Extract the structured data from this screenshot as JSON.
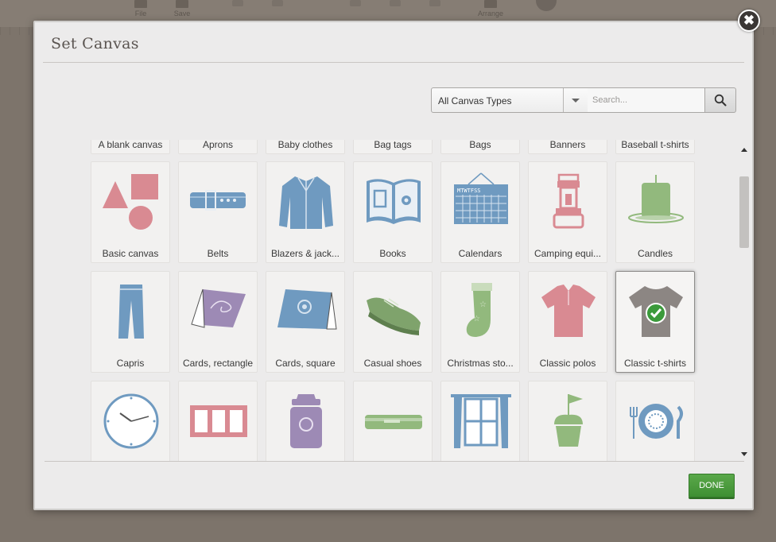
{
  "background_toolbar": {
    "file_label": "File",
    "save_label": "Save",
    "arrange_label": "Arrange"
  },
  "dialog": {
    "title": "Set Canvas",
    "close_label": "✖"
  },
  "filter": {
    "canvas_type": "All Canvas Types",
    "search_placeholder": "Search..."
  },
  "tiles_partial": [
    "A blank canvas",
    "Aprons",
    "Baby clothes",
    "Bag tags",
    "Bags",
    "Banners",
    "Baseball t-shirts"
  ],
  "tiles_row1": [
    "Basic canvas",
    "Belts",
    "Blazers & jack...",
    "Books",
    "Calendars",
    "Camping equi...",
    "Candles"
  ],
  "tiles_row2": [
    "Capris",
    "Cards, rectangle",
    "Cards, square",
    "Casual shoes",
    "Christmas sto...",
    "Classic polos",
    "Classic t-shirts"
  ],
  "tiles_row3_icons": [
    "clock-icon",
    "frame-icon",
    "jar-icon",
    "cutting-machine-icon",
    "window-icon",
    "cupcake-icon",
    "place-setting-icon"
  ],
  "selected_tile": "Classic t-shirts",
  "calendar_days": "MTWTFSS",
  "done_label": "DONE",
  "colors": {
    "pink": "#d98a92",
    "blue": "#6f9ac0",
    "green": "#92b97d",
    "purple": "#9d8ab5",
    "check_green": "#3b9a3b",
    "done_green": "#4a9c3c"
  }
}
